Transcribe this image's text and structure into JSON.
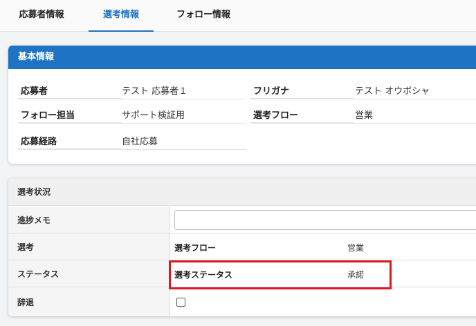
{
  "tabs": [
    {
      "label": "応募者情報"
    },
    {
      "label": "選考情報"
    },
    {
      "label": "フォロー情報"
    }
  ],
  "basic_info": {
    "title": "基本情報",
    "fields": {
      "applicant": {
        "label": "応募者",
        "value": "テスト 応募者１"
      },
      "furigana": {
        "label": "フリガナ",
        "value": "テスト オウボシャ"
      },
      "follow_owner": {
        "label": "フォロー担当",
        "value": "サポート検証用"
      },
      "selection_flow": {
        "label": "選考フロー",
        "value": "営業"
      },
      "source": {
        "label": "応募経路",
        "value": "自社応募"
      }
    }
  },
  "selection_status": {
    "title": "選考状況",
    "rows": {
      "memo": {
        "label": "進捗メモ",
        "value": ""
      },
      "selection": {
        "label": "選考",
        "sub_label": "選考フロー",
        "value": "営業"
      },
      "status": {
        "label": "ステータス",
        "sub_label": "選考ステータス",
        "value": "承諾"
      },
      "decline": {
        "label": "辞退",
        "checked": false
      }
    }
  },
  "colors": {
    "accent": "#1f73c4",
    "highlight": "#e0151f"
  }
}
